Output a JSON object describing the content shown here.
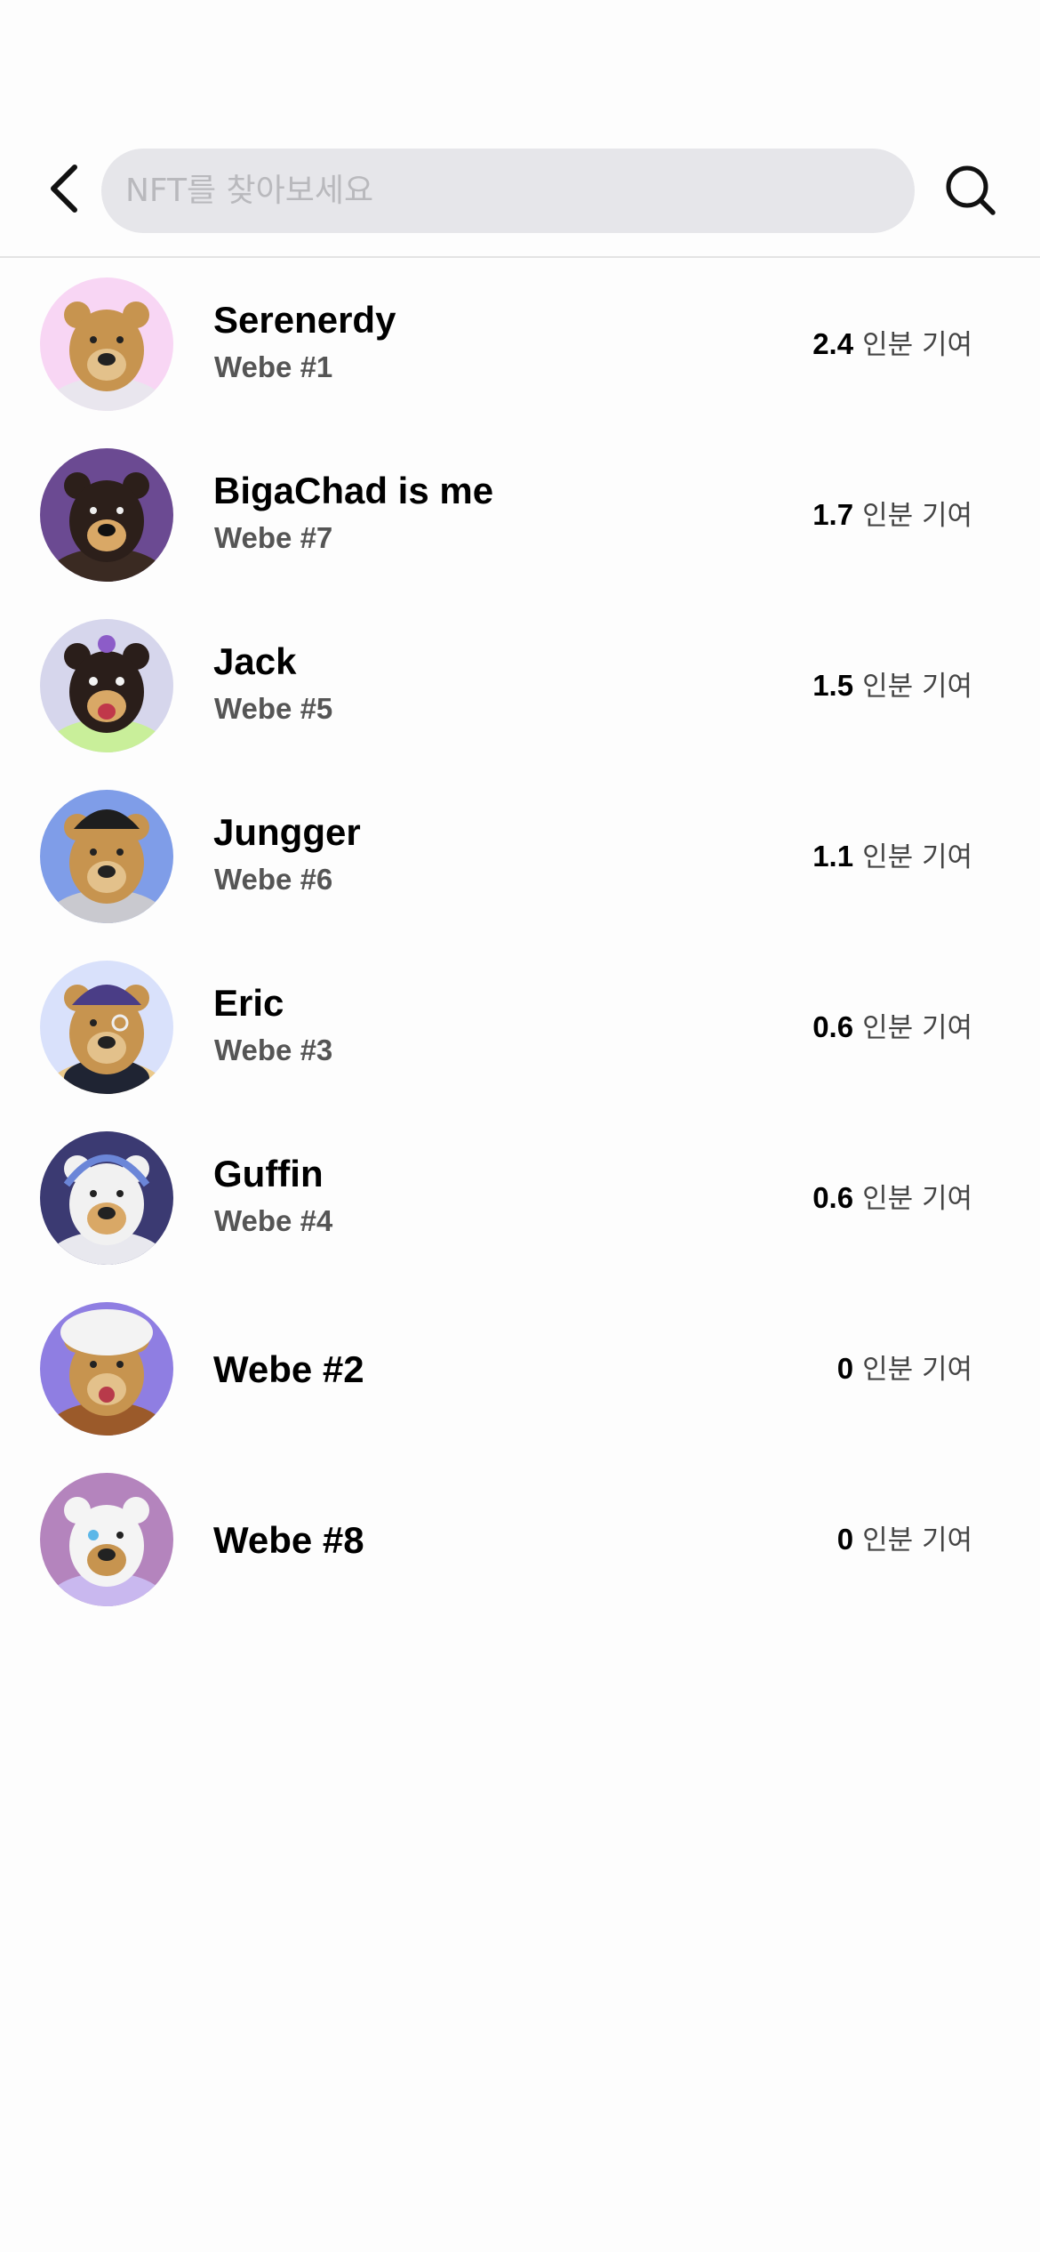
{
  "search": {
    "placeholder": "NFT를 찾아보세요"
  },
  "icons": {
    "back": "chevron-left-icon",
    "search": "search-icon"
  },
  "colors": {
    "search_bar_bg": "#e6e6ea",
    "placeholder": "#b9b9bd",
    "subtitle": "#555555",
    "divider": "#e3e3e3"
  },
  "members": [
    {
      "name": "Serenerdy",
      "sub": "Webe #1",
      "value": "2.4",
      "unit": "인분 기여",
      "avatar_bg": "#f8d6f4"
    },
    {
      "name": "BigaChad is me",
      "sub": "Webe #7",
      "value": "1.7",
      "unit": "인분 기여",
      "avatar_bg": "#6b4a92"
    },
    {
      "name": "Jack",
      "sub": "Webe #5",
      "value": "1.5",
      "unit": "인분 기여",
      "avatar_bg": "#d6d6ec"
    },
    {
      "name": "Jungger",
      "sub": "Webe #6",
      "value": "1.1",
      "unit": "인분 기여",
      "avatar_bg": "#7f9de8"
    },
    {
      "name": "Eric",
      "sub": "Webe #3",
      "value": "0.6",
      "unit": "인분 기여",
      "avatar_bg": "#d9e1fb"
    },
    {
      "name": "Guffin",
      "sub": "Webe #4",
      "value": "0.6",
      "unit": "인분 기여",
      "avatar_bg": "#3b3a72"
    },
    {
      "name": "Webe #2",
      "sub": "",
      "value": "0",
      "unit": "인분 기여",
      "avatar_bg": "#8f7ee2"
    },
    {
      "name": "Webe #8",
      "sub": "",
      "value": "0",
      "unit": "인분 기여",
      "avatar_bg": "#b484bd"
    }
  ]
}
